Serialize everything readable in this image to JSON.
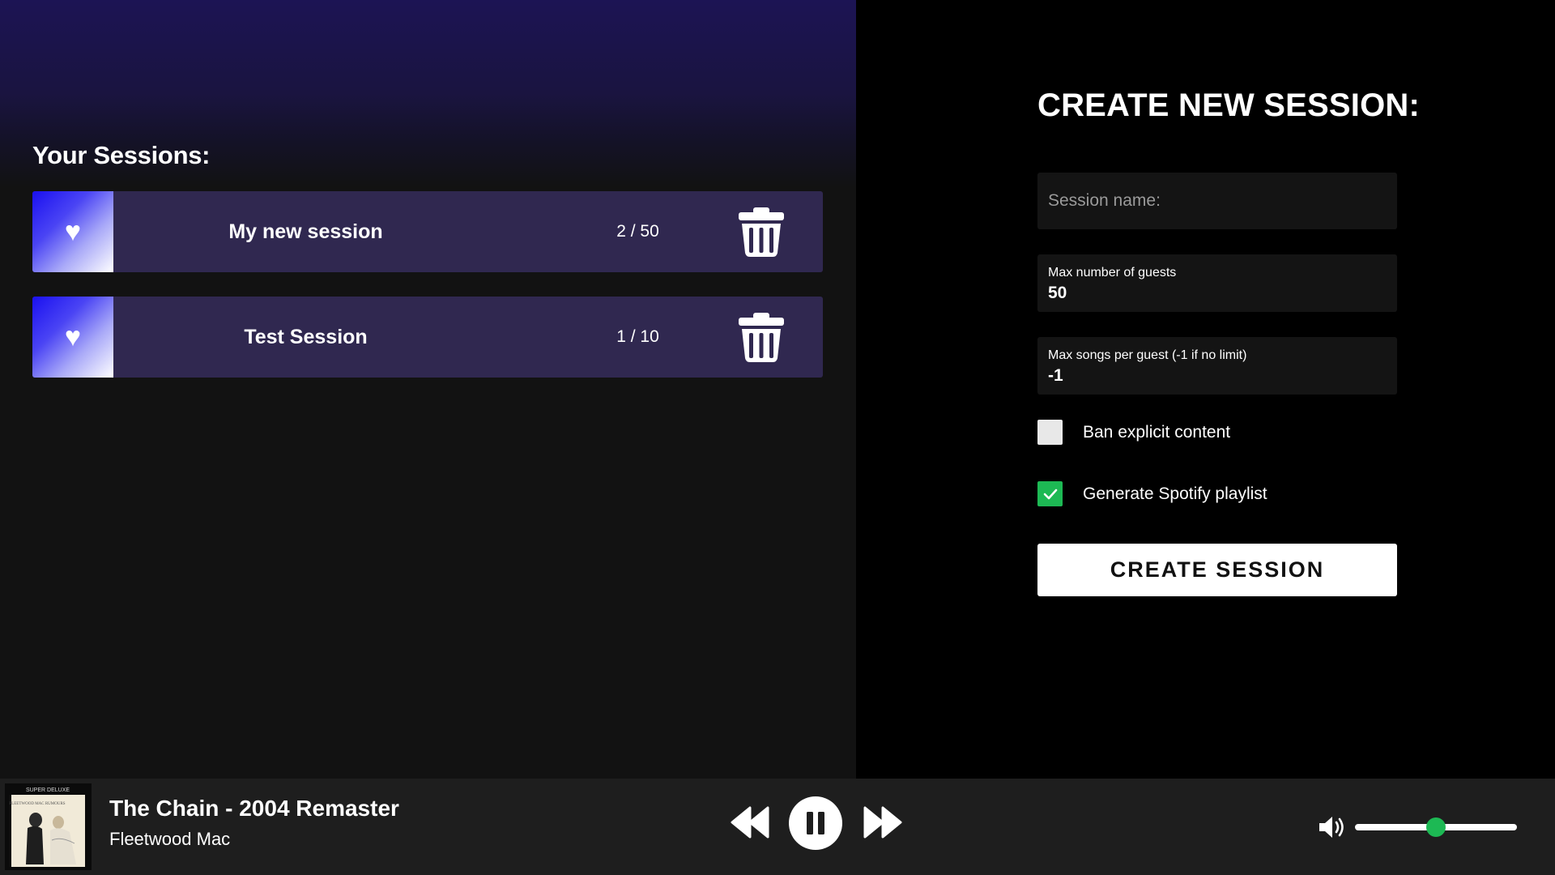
{
  "sessions": {
    "title": "Your Sessions:",
    "items": [
      {
        "name": "My new session",
        "count": "2 / 50"
      },
      {
        "name": "Test Session",
        "count": "1 / 10"
      }
    ]
  },
  "create": {
    "title": "CREATE NEW SESSION:",
    "session_name_placeholder": "Session name:",
    "max_guests_label": "Max number of guests",
    "max_guests_value": "50",
    "max_songs_label": "Max songs per guest (-1 if no limit)",
    "max_songs_value": "-1",
    "ban_explicit_label": "Ban explicit content",
    "ban_explicit_checked": false,
    "spotify_playlist_label": "Generate Spotify playlist",
    "spotify_playlist_checked": true,
    "submit_label": "CREATE SESSION"
  },
  "player": {
    "album_art_text": "SUPER DELUXE",
    "album_art_subtext": "FLEETWOOD MAC RUMOURS",
    "track_title": "The Chain - 2004 Remaster",
    "artist": "Fleetwood Mac",
    "is_playing": true,
    "volume_level": 0.5
  },
  "colors": {
    "accent_green": "#1db954",
    "session_card_bg": "#302850",
    "gradient_top": "#1c1454"
  },
  "icons": [
    "heart-icon",
    "trash-icon",
    "check-icon",
    "rewind-icon",
    "pause-icon",
    "fast-forward-icon",
    "volume-icon"
  ]
}
